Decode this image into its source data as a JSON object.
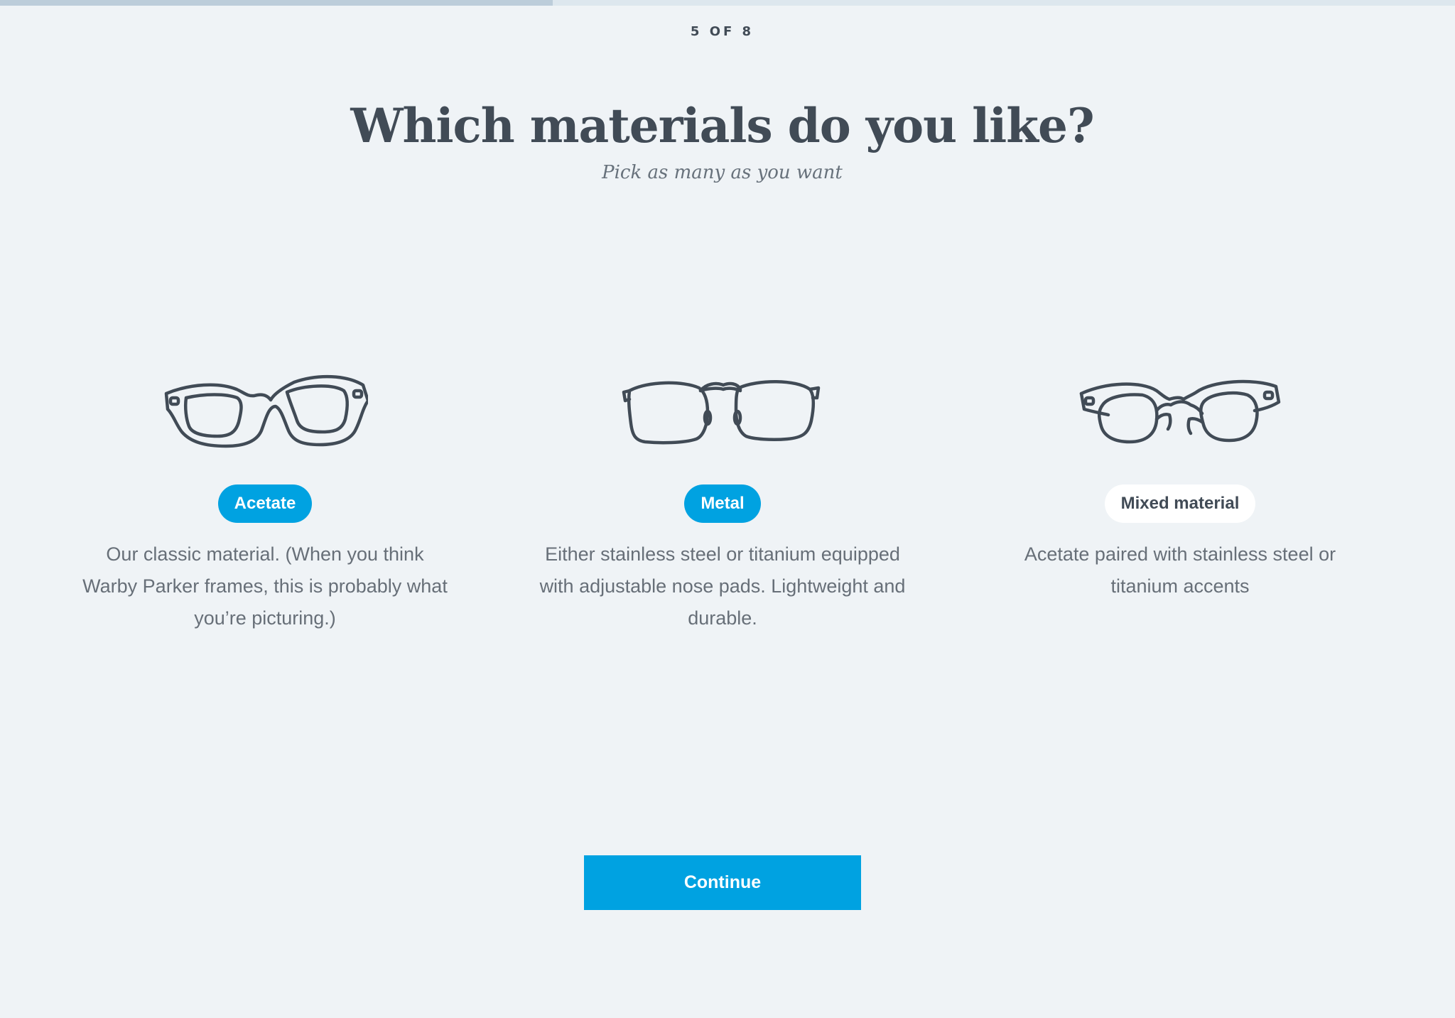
{
  "progress": {
    "current_step": 5,
    "total_steps": 8,
    "fraction": 0.38,
    "label": "5 OF 8"
  },
  "header": {
    "title": "Which materials do you like?",
    "subtitle": "Pick as many as you want"
  },
  "options": [
    {
      "label": "Acetate",
      "selected": true,
      "icon": "acetate-glasses-icon",
      "description": "Our classic material. (When you think Warby Parker frames, this is probably what you’re picturing.)"
    },
    {
      "label": "Metal",
      "selected": true,
      "icon": "metal-glasses-icon",
      "description": "Either stainless steel or titanium equipped with adjustable nose pads. Lightweight and durable."
    },
    {
      "label": "Mixed material",
      "selected": false,
      "icon": "mixed-material-glasses-icon",
      "description": "Acetate paired with stainless steel or titanium accents"
    }
  ],
  "actions": {
    "continue_label": "Continue"
  },
  "colors": {
    "accent": "#00a2e1",
    "background": "#eff3f6",
    "text_dark": "#414b56",
    "text_muted": "#676f78",
    "progress_fill": "#bccdda",
    "progress_track": "#dde7ee"
  }
}
